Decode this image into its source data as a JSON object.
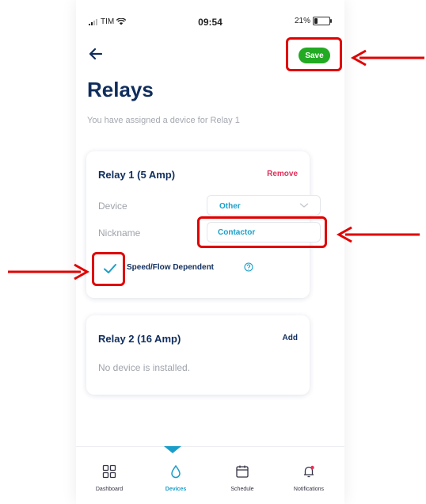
{
  "status_bar": {
    "carrier": "TIM",
    "time": "09:54",
    "battery_percent": "21%",
    "battery_level": 0.21
  },
  "header": {
    "save_label": "Save",
    "title": "Relays",
    "subtitle": "You have assigned a device for Relay 1"
  },
  "relay1": {
    "title": "Relay 1 (5 Amp)",
    "action": "Remove",
    "device_label": "Device",
    "device_value": "Other",
    "nickname_label": "Nickname",
    "nickname_value": "Contactor",
    "checkbox_label": "Speed/Flow Dependent",
    "checked": true
  },
  "relay2": {
    "title": "Relay 2 (16 Amp)",
    "action": "Add",
    "empty_text": "No device is installed."
  },
  "tabs": [
    {
      "label": "Dashboard",
      "icon": "grid-icon"
    },
    {
      "label": "Devices",
      "icon": "drop-icon",
      "active": true
    },
    {
      "label": "Schedule",
      "icon": "calendar-icon"
    },
    {
      "label": "Notifications",
      "icon": "bell-icon"
    }
  ],
  "colors": {
    "accent": "#1a9ec9",
    "navy": "#0f2d5c",
    "save_green": "#22aa22",
    "remove_red": "#e0305a",
    "annotation_red": "#e00000"
  }
}
